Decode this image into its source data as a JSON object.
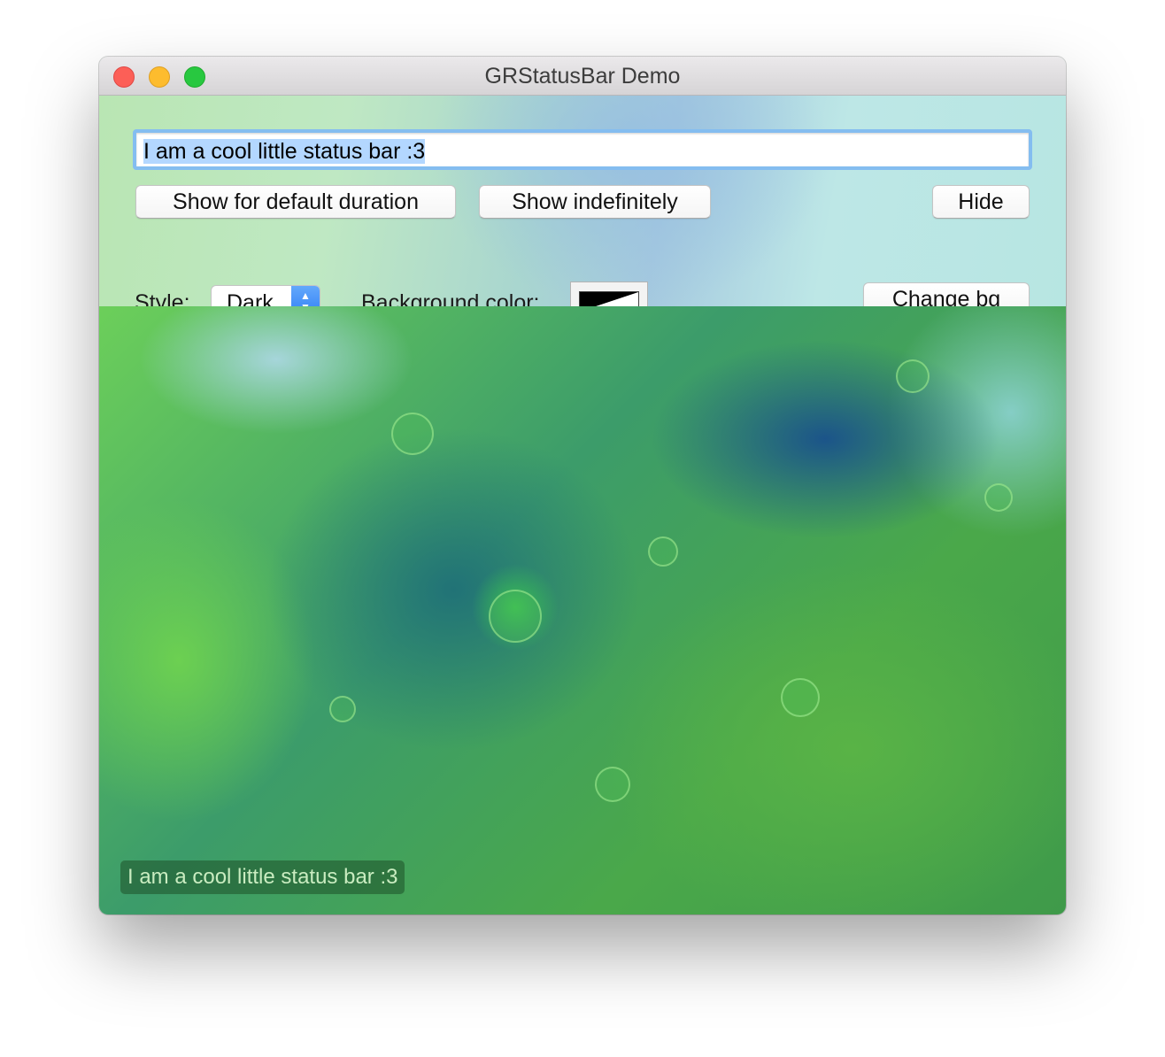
{
  "window": {
    "title": "GRStatusBar Demo"
  },
  "controls": {
    "message_field_value": "I am a cool little status bar :3",
    "show_default_label": "Show for default duration",
    "show_indefinitely_label": "Show indefinitely",
    "hide_label": "Hide",
    "style_label": "Style:",
    "style_selected": "Dark",
    "background_color_label": "Background color:",
    "change_bg_label": "Change bg"
  },
  "status_bar": {
    "text": "I am a cool little status bar :3"
  },
  "colors": {
    "status_bar_background": "#1e5028",
    "focus_ring": "#84bdf0",
    "popup_accent": "#2c7cf6"
  },
  "icons": {
    "close": "close-icon",
    "minimize": "minimize-icon",
    "zoom": "zoom-icon",
    "popup_arrows": "chevron-up-down-icon"
  }
}
